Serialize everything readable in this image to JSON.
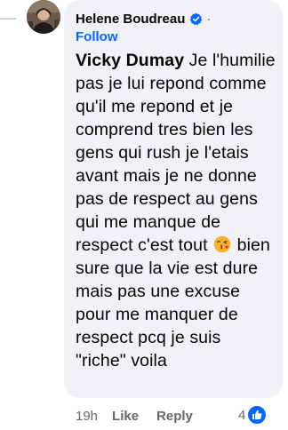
{
  "comment": {
    "author": "Helene Boudreau",
    "separator": "·",
    "follow_label": "Follow",
    "mention": "Vicky Dumay",
    "text_before_emoji": " Je l'humilie pas je lui repond comme qu'il me repond et je comprend tres bien les gens qui rush je l'etais avant mais je ne donne pas de respect au gens qui me manque de respect c'est tout ",
    "emoji": "kissing-face-with-heart-emoji",
    "text_after_emoji": " bien sure que la vie est dure mais pas une excuse pour me manquer de respect pcq je suis \"riche\" voila"
  },
  "actions": {
    "time": "19h",
    "like_label": "Like",
    "reply_label": "Reply"
  },
  "reactions": {
    "count": "4",
    "icon": "like-reaction-icon"
  },
  "colors": {
    "bubble": "#f0f2f5",
    "link_blue": "#0866ff",
    "meta_gray": "#65676b",
    "verified_blue": "#0866ff"
  }
}
